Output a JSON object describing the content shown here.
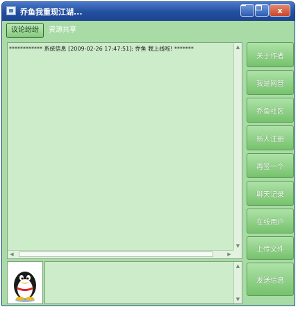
{
  "window": {
    "title": "乔鱼我重现江湖...",
    "minimize_glyph": "",
    "maximize_glyph": "",
    "close_glyph": "x"
  },
  "tabs": [
    {
      "label": "议论纷纷",
      "active": true
    },
    {
      "label": "资源共享",
      "active": false
    }
  ],
  "chat": {
    "messages": [
      "************ 系统信息 [2009-02-26 17:47:51]: 乔鱼 我上线啦! *******"
    ]
  },
  "sidebar": {
    "buttons": [
      "关于作者",
      "我是网管",
      "乔鱼社区",
      "新人注册",
      "再签一个",
      "聊天记录",
      "在线用户",
      "上传文件"
    ]
  },
  "send_button": "发送信息",
  "avatar": {
    "icon": "penguin-icon"
  },
  "colors": {
    "window_bg": "#a9dba7",
    "titlebar": "#234f9f",
    "pane_bg": "#ccecca",
    "button_green": "#8ed286"
  }
}
